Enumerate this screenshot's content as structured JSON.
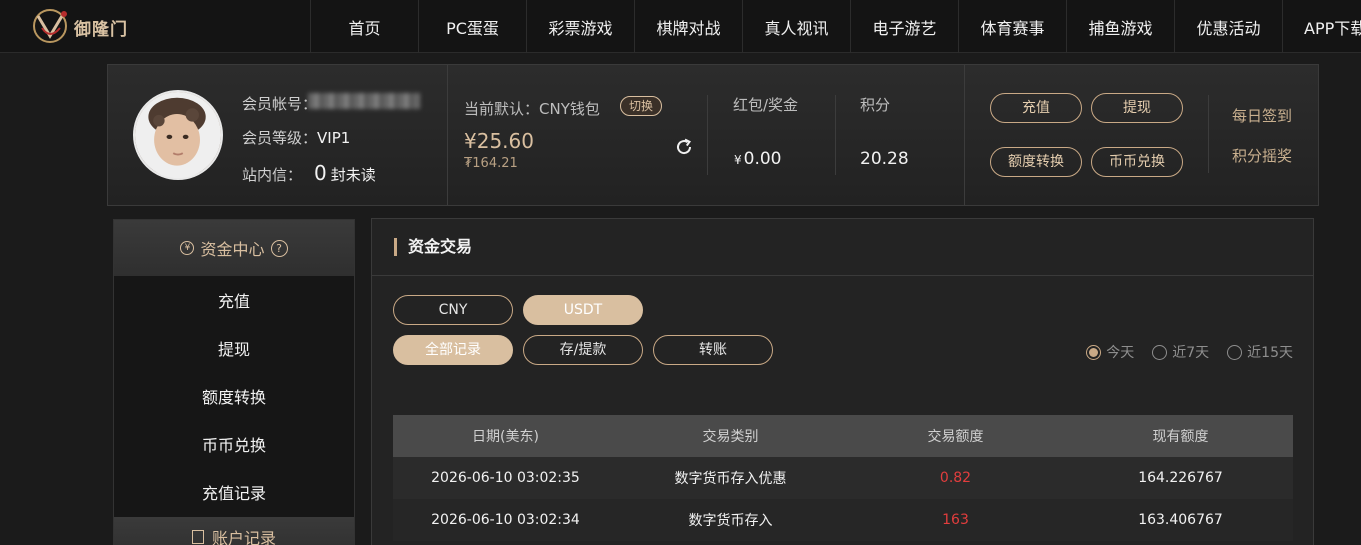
{
  "brand": {
    "name": "御隆门"
  },
  "nav": {
    "items": [
      "首页",
      "PC蛋蛋",
      "彩票游戏",
      "棋牌对战",
      "真人视讯",
      "电子游艺",
      "体育赛事",
      "捕鱼游戏",
      "优惠活动",
      "APP下载"
    ]
  },
  "profile": {
    "account_label": "会员帐号：",
    "level_label": "会员等级：",
    "level_value": "VIP1",
    "message_label": "站内信：",
    "message_count": "0",
    "message_unit": "封未读",
    "wallet_label": "当前默认：CNY钱包",
    "switch_label": "切换",
    "wallet_main": "¥25.60",
    "wallet_sub": "₮164.21",
    "bonus_label": "红包/奖金",
    "bonus_currency": "¥",
    "bonus_value": "0.00",
    "points_label": "积分",
    "points_value": "20.28",
    "actions": {
      "deposit": "充值",
      "withdraw": "提现",
      "transfer": "额度转换",
      "exchange": "币币兑换"
    },
    "links": {
      "checkin": "每日签到",
      "lottery": "积分摇奖"
    }
  },
  "sidebar": {
    "header": "资金中心",
    "items": [
      "充值",
      "提现",
      "额度转换",
      "币币兑换",
      "充值记录"
    ],
    "next_header": "账户记录"
  },
  "main": {
    "title": "资金交易",
    "currency_tabs": [
      "CNY",
      "USDT"
    ],
    "type_tabs": [
      "全部记录",
      "存/提款",
      "转账"
    ],
    "date_filters": [
      "今天",
      "近7天",
      "近15天"
    ],
    "table": {
      "headers": [
        "日期(美东)",
        "交易类别",
        "交易额度",
        "现有额度"
      ],
      "rows": [
        [
          "2026-06-10 03:02:35",
          "数字货币存入优惠",
          "0.82",
          "164.226767"
        ],
        [
          "2026-06-10 03:02:34",
          "数字货币存入",
          "163",
          "163.406767"
        ]
      ]
    }
  },
  "colors": {
    "accent": "#d9bfa0",
    "amount": "#e23d3d"
  }
}
